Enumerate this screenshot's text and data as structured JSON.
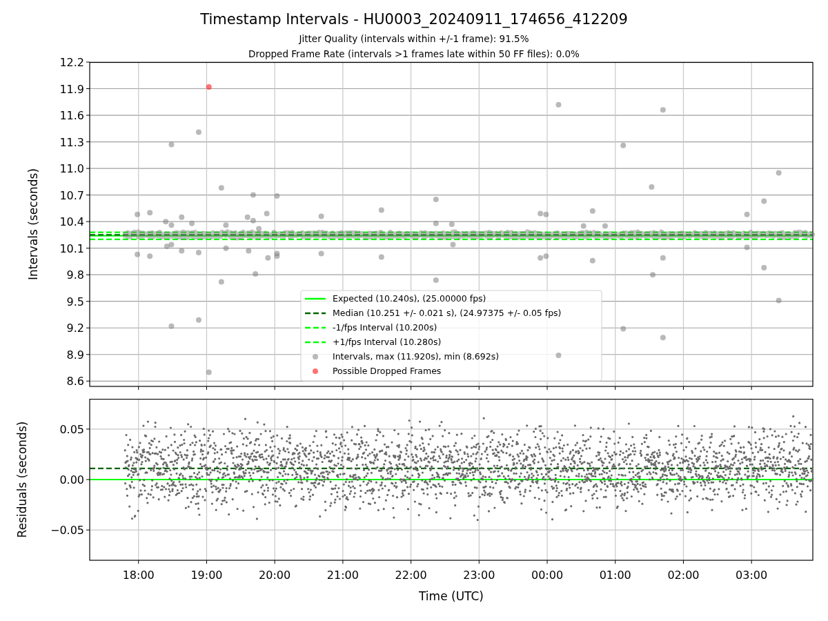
{
  "figure": {
    "title": "Timestamp Intervals - HU0003_20240911_174656_412209",
    "subtitles": [
      "Jitter Quality (intervals within +/-1 frame): 91.5%",
      "Dropped Frame Rate (intervals >1 frames late within 50 FF files): 0.0%"
    ]
  },
  "interval_chart": {
    "chart_data": {
      "type": "scatter",
      "ylabel": "Intervals (seconds)",
      "grid": true,
      "legend": true,
      "xlim": [
        "2024-09-11T17:17",
        "2024-09-12T03:54"
      ],
      "ylim": [
        8.54,
        12.2
      ],
      "yticks": [
        {
          "value": 8.6,
          "label": "8.6"
        },
        {
          "value": 8.9,
          "label": "8.9"
        },
        {
          "value": 9.2,
          "label": "9.2"
        },
        {
          "value": 9.5,
          "label": "9.5"
        },
        {
          "value": 9.8,
          "label": "9.8"
        },
        {
          "value": 10.1,
          "label": "10.1"
        },
        {
          "value": 10.4,
          "label": "10.4"
        },
        {
          "value": 10.7,
          "label": "10.7"
        },
        {
          "value": 11.0,
          "label": "11.0"
        },
        {
          "value": 11.3,
          "label": "11.3"
        },
        {
          "value": 11.6,
          "label": "11.6"
        },
        {
          "value": 11.9,
          "label": "11.9"
        },
        {
          "value": 12.2,
          "label": "12.2"
        }
      ],
      "ref_lines": [
        {
          "axis": "y",
          "value": 10.24,
          "label": "Expected (10.240s), (25.00000 fps)",
          "color": "#00ff00"
        },
        {
          "axis": "y",
          "value": 10.251,
          "label": "Median (10.251 +/- 0.021 s), (24.97375 +/- 0.05 fps)",
          "color": "#006400"
        },
        {
          "axis": "y",
          "value": 10.2,
          "label": "-1/fps Interval (10.200s)",
          "color": "#00ff00"
        },
        {
          "axis": "y",
          "value": 10.28,
          "label": "+1/fps Interval (10.280s)",
          "color": "#00ff00"
        }
      ],
      "series": [
        {
          "name": "Intervals, max (11.920s), min (8.692s)",
          "color": "#808080",
          "x": [
            "2024-09-11T17:59",
            "2024-09-11T17:59",
            "2024-09-11T18:10",
            "2024-09-11T18:10",
            "2024-09-11T18:24",
            "2024-09-11T18:25",
            "2024-09-11T18:29",
            "2024-09-11T18:29",
            "2024-09-11T18:29",
            "2024-09-11T18:29",
            "2024-09-11T18:38",
            "2024-09-11T18:38",
            "2024-09-11T18:47",
            "2024-09-11T18:53",
            "2024-09-11T18:53",
            "2024-09-11T18:53",
            "2024-09-11T19:02",
            "2024-09-11T19:13",
            "2024-09-11T19:13",
            "2024-09-11T19:17",
            "2024-09-11T19:17",
            "2024-09-11T19:36",
            "2024-09-11T19:37",
            "2024-09-11T19:41",
            "2024-09-11T19:41",
            "2024-09-11T19:43",
            "2024-09-11T19:46",
            "2024-09-11T19:53",
            "2024-09-11T19:54",
            "2024-09-11T20:02",
            "2024-09-11T20:02",
            "2024-09-11T20:02",
            "2024-09-11T20:41",
            "2024-09-11T20:41",
            "2024-09-11T21:34",
            "2024-09-11T21:34",
            "2024-09-11T22:22",
            "2024-09-11T22:22",
            "2024-09-11T22:22",
            "2024-09-11T22:36",
            "2024-09-11T22:37",
            "2024-09-11T23:54",
            "2024-09-11T23:54",
            "2024-09-11T23:59",
            "2024-09-11T23:59",
            "2024-09-12T00:10",
            "2024-09-12T00:10",
            "2024-09-12T00:32",
            "2024-09-12T00:40",
            "2024-09-12T00:40",
            "2024-09-12T00:51",
            "2024-09-12T01:07",
            "2024-09-12T01:07",
            "2024-09-12T01:32",
            "2024-09-12T01:33",
            "2024-09-12T01:42",
            "2024-09-12T01:42",
            "2024-09-12T01:42",
            "2024-09-12T02:56",
            "2024-09-12T02:56",
            "2024-09-12T03:11",
            "2024-09-12T03:11",
            "2024-09-12T03:24",
            "2024-09-12T03:24"
          ],
          "values": [
            10.48,
            10.03,
            10.5,
            10.01,
            10.4,
            10.12,
            11.27,
            10.36,
            10.14,
            9.22,
            10.45,
            10.07,
            10.38,
            10.05,
            9.29,
            11.41,
            8.7,
            10.78,
            9.72,
            10.36,
            10.1,
            10.45,
            10.07,
            10.7,
            10.41,
            9.81,
            10.32,
            10.49,
            9.99,
            10.69,
            10.04,
            10.01,
            10.46,
            10.04,
            10.53,
            10.0,
            10.65,
            10.38,
            9.74,
            10.37,
            10.14,
            10.49,
            9.99,
            10.48,
            10.01,
            11.72,
            8.89,
            10.35,
            10.52,
            9.96,
            10.35,
            9.19,
            11.26,
            10.79,
            9.8,
            11.66,
            9.99,
            9.09,
            10.48,
            10.11,
            10.63,
            9.88,
            10.95,
            9.51
          ]
        },
        {
          "name": "Possible Dropped Frames",
          "color": "#ff0000",
          "x": [
            "2024-09-11T19:02"
          ],
          "values": [
            11.92
          ]
        }
      ]
    }
  },
  "residual_chart": {
    "chart_data": {
      "type": "scatter",
      "xlabel": "Time (UTC)",
      "ylabel": "Residuals (seconds)",
      "grid": true,
      "xlim": [
        "2024-09-11T17:17",
        "2024-09-12T03:54"
      ],
      "ylim": [
        -0.08,
        0.08
      ],
      "xticks": [
        {
          "value": "2024-09-11T18:00",
          "label": "18:00"
        },
        {
          "value": "2024-09-11T19:00",
          "label": "19:00"
        },
        {
          "value": "2024-09-11T20:00",
          "label": "20:00"
        },
        {
          "value": "2024-09-11T21:00",
          "label": "21:00"
        },
        {
          "value": "2024-09-11T22:00",
          "label": "22:00"
        },
        {
          "value": "2024-09-11T23:00",
          "label": "23:00"
        },
        {
          "value": "2024-09-12T00:00",
          "label": "00:00"
        },
        {
          "value": "2024-09-12T01:00",
          "label": "01:00"
        },
        {
          "value": "2024-09-12T02:00",
          "label": "02:00"
        },
        {
          "value": "2024-09-12T03:00",
          "label": "03:00"
        }
      ],
      "yticks": [
        {
          "value": 0.05,
          "label": "0.05"
        },
        {
          "value": 0,
          "label": "0.00"
        },
        {
          "value": -0.05,
          "label": "−0.05"
        }
      ],
      "ref_lines": [
        {
          "axis": "y",
          "value": 0,
          "color": "#00ff00"
        },
        {
          "axis": "y",
          "value": 0.011,
          "color": "#006400"
        }
      ]
    }
  }
}
